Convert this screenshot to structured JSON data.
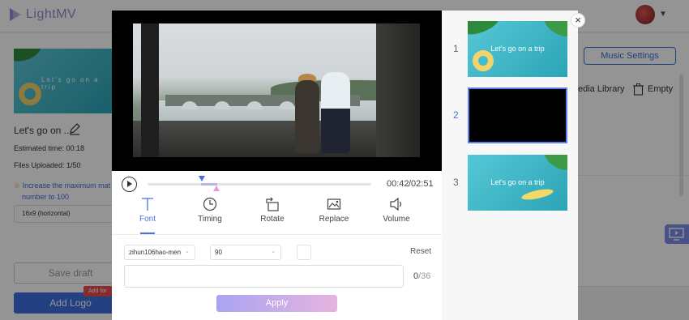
{
  "app": {
    "brand": "LightMV"
  },
  "left_panel": {
    "thumb_text": "Let's go on a trip",
    "project_name": "Let's go on ...",
    "estimated_time": "Estimated time: 00:18",
    "files_uploaded": "Files Uploaded: 1/50",
    "increase_text": "Increase the maximum mat",
    "increase_text_2": "number to 100",
    "ratio": "16x9 (horizontal)",
    "save_draft": "Save draft",
    "add_logo": "Add Logo",
    "add_for_badge": "Add for"
  },
  "right_panel": {
    "music_settings": "Music Settings",
    "media_library": "edia Library",
    "empty": "Empty"
  },
  "editor": {
    "time_current": "00:42",
    "time_total": "/02:51",
    "tools": [
      {
        "label": "Font",
        "icon": "font-icon"
      },
      {
        "label": "Timing",
        "icon": "clock-icon"
      },
      {
        "label": "Rotate",
        "icon": "rotate-icon"
      },
      {
        "label": "Replace",
        "icon": "replace-icon"
      },
      {
        "label": "Volume",
        "icon": "volume-icon"
      }
    ],
    "font_select": "zihun106hao-men",
    "size_select": "90",
    "reset": "Reset",
    "text_value": "",
    "char_count": "0",
    "char_max": "/36",
    "apply": "Apply"
  },
  "clips": [
    {
      "number": "1",
      "caption": "Let's go on a trip"
    },
    {
      "number": "2",
      "caption": ""
    },
    {
      "number": "3",
      "caption": "Let's go on a trip"
    }
  ],
  "colors": {
    "accent": "#4a6fe0",
    "apply_start": "#a9a4f2",
    "apply_end": "#e6b4e0"
  }
}
